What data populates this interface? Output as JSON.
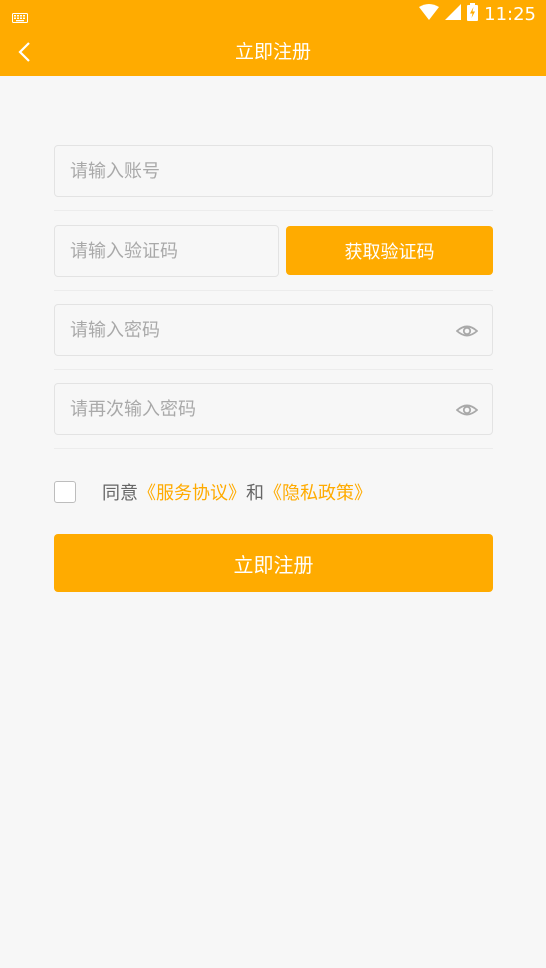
{
  "status_bar": {
    "time": "11:25"
  },
  "header": {
    "title": "立即注册"
  },
  "form": {
    "account_placeholder": "请输入账号",
    "code_placeholder": "请输入验证码",
    "get_code_label": "获取验证码",
    "password_placeholder": "请输入密码",
    "confirm_placeholder": "请再次输入密码"
  },
  "agreement": {
    "prefix": "同意",
    "service_link": "《服务协议》",
    "conjunction": "和",
    "privacy_link": "《隐私政策》",
    "checked": false
  },
  "submit_label": "立即注册",
  "colors": {
    "accent": "#ffab00",
    "background": "#f7f7f7"
  }
}
